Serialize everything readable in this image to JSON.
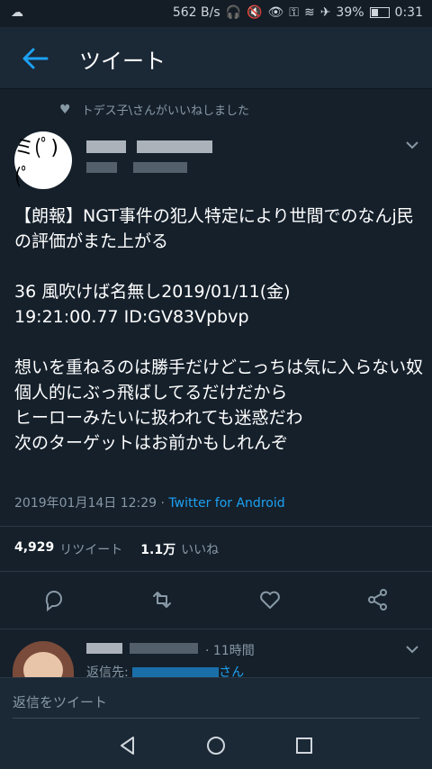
{
  "status": {
    "net_speed": "562 B/s",
    "battery": "39%",
    "battery_level": 0.39,
    "time": "0:31"
  },
  "appbar": {
    "title": "ツイート"
  },
  "liked_by": "トデス子\\さんがいいねしました",
  "avatar_text": "ミ(ﾟ)(ﾟ",
  "tweet": {
    "text": "【朗報】NGT事件の犯人特定により世間でのなんj民の評価がまた上がる\n\n36 風吹けば名無し2019/01/11(金)\n19:21:00.77 ID:GV83Vpbvp\n\n想いを重ねるのは勝手だけどこっちは気に入らない奴個人的にぶっ飛ばしてるだけだから\nヒーローみたいに扱われても迷惑だわ\n次のターゲットはお前かもしれんぞ",
    "date": "2019年01月14日 12:29 · ",
    "source": "Twitter for Android"
  },
  "stats": {
    "retweets": "4,929",
    "retweets_label": "リツイート",
    "likes": "1.1万",
    "likes_label": "いいね"
  },
  "reply": {
    "time": "11時間",
    "reply_to_prefix": "返信先: ",
    "reply_to_suffix": "さん"
  },
  "composer": {
    "placeholder": "返信をツイート"
  },
  "icons": {
    "back": "arrow-left-icon",
    "reply": "reply-icon",
    "retweet": "retweet-icon",
    "like": "heart-icon",
    "share": "share-icon"
  },
  "colors": {
    "background": "#15202b",
    "accent": "#1da1f2",
    "muted": "#8899a6"
  }
}
